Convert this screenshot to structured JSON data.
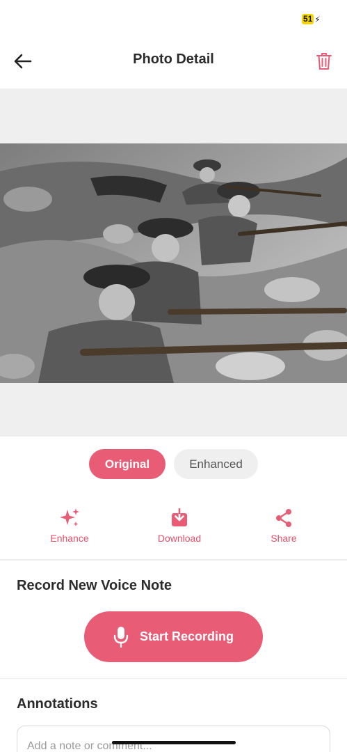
{
  "status_bar": {
    "battery_level": "51",
    "battery_charging_icon": "bolt-icon"
  },
  "header": {
    "title": "Photo Detail",
    "back_icon": "arrow-left-icon",
    "delete_icon": "trash-icon"
  },
  "photo": {
    "alt": "Soldiers in helmets aiming rifles from a rocky trench"
  },
  "toggle": {
    "original_label": "Original",
    "enhanced_label": "Enhanced",
    "selected": "Original"
  },
  "actions": [
    {
      "label": "Enhance",
      "icon": "sparkles-icon"
    },
    {
      "label": "Download",
      "icon": "download-icon"
    },
    {
      "label": "Share",
      "icon": "share-icon"
    }
  ],
  "voice_note": {
    "heading": "Record New Voice Note",
    "button_label": "Start Recording",
    "button_icon": "microphone-icon"
  },
  "annotations": {
    "heading": "Annotations",
    "placeholder": "Add a note or comment..."
  },
  "colors": {
    "accent": "#e85d75",
    "background": "#ffffff",
    "photo_backdrop": "#efefef"
  }
}
